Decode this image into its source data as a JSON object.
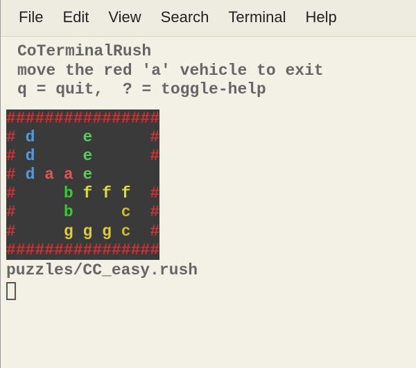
{
  "menu": {
    "file": "File",
    "edit": "Edit",
    "view": "View",
    "search": "Search",
    "terminal": "Terminal",
    "help": "Help"
  },
  "header": {
    "title": "CoTerminalRush",
    "instruction": "move the red 'a' vehicle to exit",
    "help": "q = quit,  ? = toggle-help"
  },
  "board": {
    "rows": [
      [
        [
          "hash",
          "#"
        ],
        [
          "hash",
          "#"
        ],
        [
          "hash",
          "#"
        ],
        [
          "hash",
          "#"
        ],
        [
          "hash",
          "#"
        ],
        [
          "hash",
          "#"
        ],
        [
          "hash",
          "#"
        ],
        [
          "hash",
          "#"
        ],
        [
          "hash",
          "#"
        ],
        [
          "hash",
          "#"
        ],
        [
          "hash",
          "#"
        ],
        [
          "hash",
          "#"
        ],
        [
          "hash",
          "#"
        ],
        [
          "hash",
          "#"
        ],
        [
          "hash",
          "#"
        ],
        [
          "hash",
          "#"
        ]
      ],
      [
        [
          "hash",
          "#"
        ],
        [
          "",
          ""
        ],
        [
          "d",
          "d"
        ],
        [
          "",
          ""
        ],
        [
          "",
          ""
        ],
        [
          "",
          ""
        ],
        [
          "",
          ""
        ],
        [
          "",
          ""
        ],
        [
          "e",
          "e"
        ],
        [
          "",
          ""
        ],
        [
          "",
          ""
        ],
        [
          "",
          ""
        ],
        [
          "",
          ""
        ],
        [
          "",
          ""
        ],
        [
          "",
          ""
        ],
        [
          "hash",
          "#"
        ]
      ],
      [
        [
          "hash",
          "#"
        ],
        [
          "",
          ""
        ],
        [
          "d",
          "d"
        ],
        [
          "",
          ""
        ],
        [
          "",
          ""
        ],
        [
          "",
          ""
        ],
        [
          "",
          ""
        ],
        [
          "",
          ""
        ],
        [
          "e",
          "e"
        ],
        [
          "",
          ""
        ],
        [
          "",
          ""
        ],
        [
          "",
          ""
        ],
        [
          "",
          ""
        ],
        [
          "",
          ""
        ],
        [
          "",
          ""
        ],
        [
          "hash",
          "#"
        ]
      ],
      [
        [
          "hash",
          "#"
        ],
        [
          "",
          ""
        ],
        [
          "d",
          "d"
        ],
        [
          "",
          ""
        ],
        [
          "a",
          "a"
        ],
        [
          "",
          ""
        ],
        [
          "a",
          "a"
        ],
        [
          "",
          ""
        ],
        [
          "e",
          "e"
        ],
        [
          "",
          ""
        ],
        [
          "",
          ""
        ],
        [
          "",
          ""
        ],
        [
          "",
          ""
        ],
        [
          "",
          ""
        ],
        [
          "",
          ""
        ],
        [
          "",
          ""
        ]
      ],
      [
        [
          "hash",
          "#"
        ],
        [
          "",
          ""
        ],
        [
          "",
          ""
        ],
        [
          "",
          ""
        ],
        [
          "",
          ""
        ],
        [
          "",
          ""
        ],
        [
          "b",
          "b"
        ],
        [
          "",
          ""
        ],
        [
          "f",
          "f"
        ],
        [
          "",
          ""
        ],
        [
          "f",
          "f"
        ],
        [
          "",
          ""
        ],
        [
          "f",
          "f"
        ],
        [
          "",
          ""
        ],
        [
          "",
          ""
        ],
        [
          "hash",
          "#"
        ]
      ],
      [
        [
          "hash",
          "#"
        ],
        [
          "",
          ""
        ],
        [
          "",
          ""
        ],
        [
          "",
          ""
        ],
        [
          "",
          ""
        ],
        [
          "",
          ""
        ],
        [
          "b",
          "b"
        ],
        [
          "",
          ""
        ],
        [
          "",
          ""
        ],
        [
          "",
          ""
        ],
        [
          "",
          ""
        ],
        [
          "",
          ""
        ],
        [
          "c",
          "c"
        ],
        [
          "",
          ""
        ],
        [
          "",
          ""
        ],
        [
          "hash",
          "#"
        ]
      ],
      [
        [
          "hash",
          "#"
        ],
        [
          "",
          ""
        ],
        [
          "",
          ""
        ],
        [
          "",
          ""
        ],
        [
          "",
          ""
        ],
        [
          "",
          ""
        ],
        [
          "g",
          "g"
        ],
        [
          "",
          ""
        ],
        [
          "g",
          "g"
        ],
        [
          "",
          ""
        ],
        [
          "g",
          "g"
        ],
        [
          "",
          ""
        ],
        [
          "c",
          "c"
        ],
        [
          "",
          ""
        ],
        [
          "",
          ""
        ],
        [
          "hash",
          "#"
        ]
      ],
      [
        [
          "hash",
          "#"
        ],
        [
          "hash",
          "#"
        ],
        [
          "hash",
          "#"
        ],
        [
          "hash",
          "#"
        ],
        [
          "hash",
          "#"
        ],
        [
          "hash",
          "#"
        ],
        [
          "hash",
          "#"
        ],
        [
          "hash",
          "#"
        ],
        [
          "hash",
          "#"
        ],
        [
          "hash",
          "#"
        ],
        [
          "hash",
          "#"
        ],
        [
          "hash",
          "#"
        ],
        [
          "hash",
          "#"
        ],
        [
          "hash",
          "#"
        ],
        [
          "hash",
          "#"
        ],
        [
          "hash",
          "#"
        ]
      ]
    ]
  },
  "footer": {
    "path": "puzzles/CC_easy.rush"
  }
}
